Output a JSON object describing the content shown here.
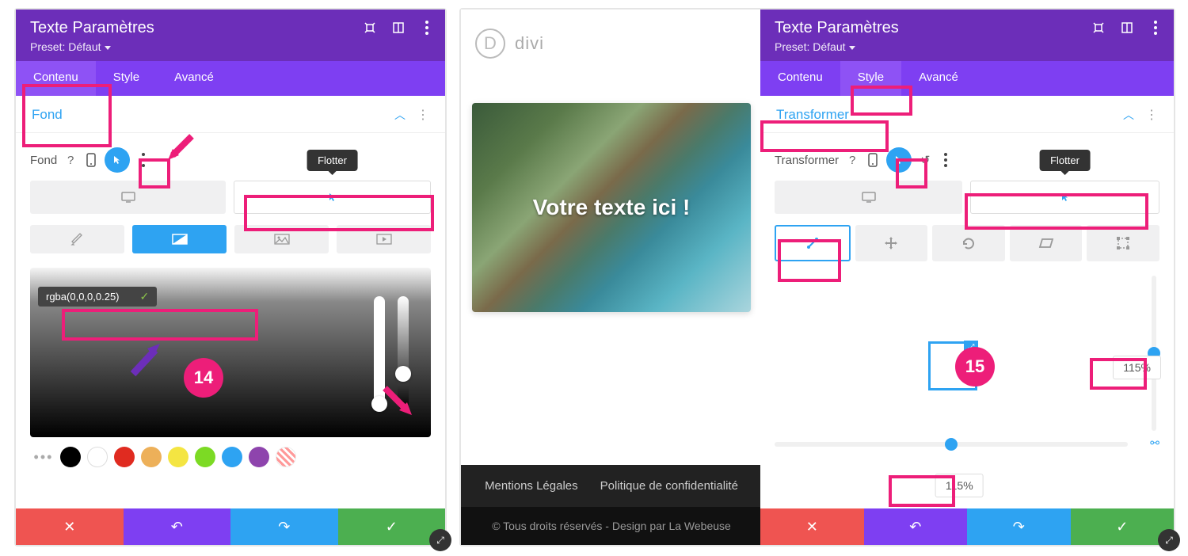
{
  "left": {
    "header": {
      "title": "Texte Paramètres",
      "preset": "Preset: Défaut"
    },
    "tabs": {
      "content": "Contenu",
      "style": "Style",
      "advanced": "Avancé"
    },
    "section": "Fond",
    "row_label": "Fond",
    "tooltip": "Flotter",
    "rgba": "rgba(0,0,0,0.25)",
    "swatches": [
      "#000000",
      "#ffffff",
      "#e02b20",
      "#edb059",
      "#f4e542",
      "#7cda24",
      "#2ea3f2",
      "#8e44ad"
    ],
    "badge": "14"
  },
  "preview": {
    "brand": "divi",
    "hero": "Votre texte ici !",
    "links": [
      "Mentions Légales",
      "Politique de confidentialité"
    ],
    "copy": "© Tous droits réservés - Design par La Webeuse"
  },
  "right": {
    "header": {
      "title": "Texte Paramètres",
      "preset": "Preset: Défaut"
    },
    "tabs": {
      "content": "Contenu",
      "style": "Style",
      "advanced": "Avancé"
    },
    "section": "Transformer",
    "row_label": "Transformer",
    "tooltip": "Flotter",
    "scale_x": "115%",
    "scale_y": "115%",
    "badge": "15"
  }
}
